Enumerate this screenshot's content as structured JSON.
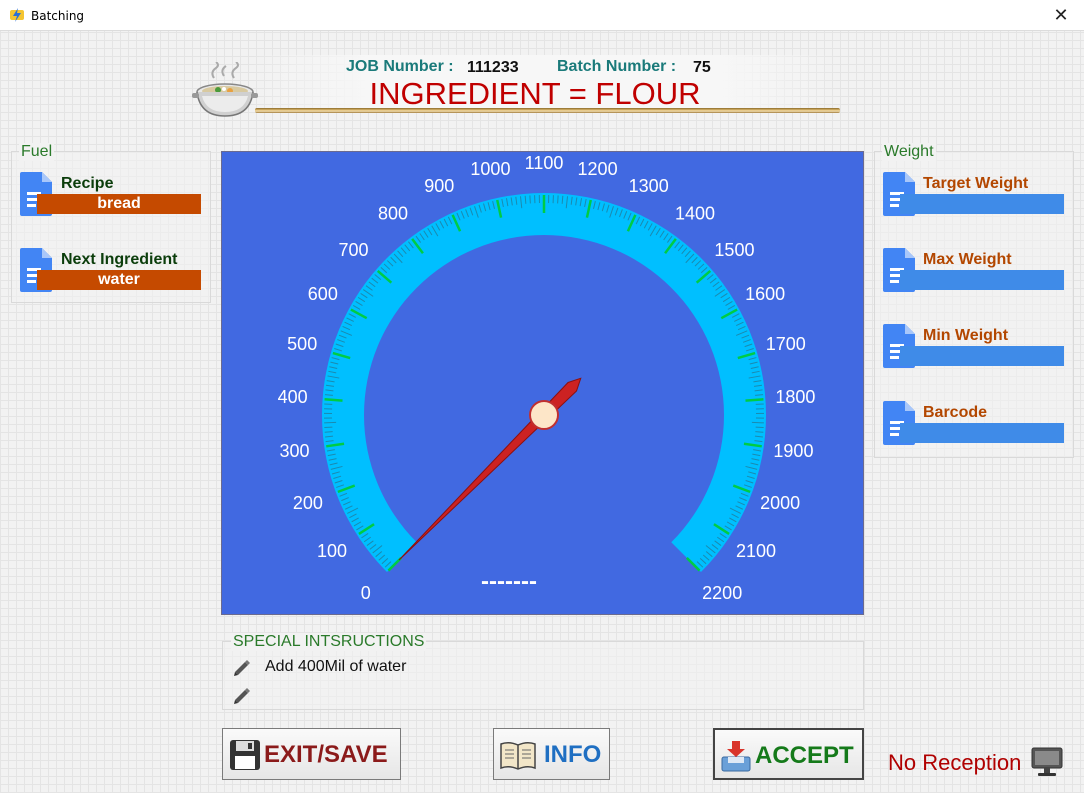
{
  "window": {
    "title": "Batching",
    "close_glyph": "✕",
    "icon": "lightning-app-icon"
  },
  "header": {
    "job_label": "JOB Number :",
    "job_value": "111233",
    "batch_label": "Batch Number :",
    "batch_value": "75",
    "ingredient": "INGREDIENT = FLOUR",
    "icon": "soup-pot-icon"
  },
  "fuel": {
    "title": "Fuel",
    "recipe_label": "Recipe",
    "recipe_value": "bread",
    "next_label": "Next Ingredient",
    "next_value": "water"
  },
  "weight": {
    "title": "Weight",
    "target_label": "Target Weight",
    "max_label": "Max Weight",
    "min_label": "Min Weight",
    "barcode_label": "Barcode"
  },
  "gauge": {
    "min": 0,
    "max": 2200,
    "major_step": 100,
    "value": 0,
    "start_angle_deg": 225,
    "end_angle_deg": -45,
    "tick_labels": [
      "0",
      "100",
      "200",
      "300",
      "400",
      "500",
      "600",
      "700",
      "800",
      "900",
      "1000",
      "1100",
      "1200",
      "1300",
      "1400",
      "1500",
      "1600",
      "1700",
      "1800",
      "1900",
      "2000",
      "2100",
      "2200"
    ],
    "readout": "-------",
    "colors": {
      "background": "#4169e1",
      "band": "#00bfff",
      "tick": "#00cc44",
      "needle": "#cc2222"
    }
  },
  "special": {
    "title": "SPECIAL INTSRUCTIONS",
    "line1": "Add 400Mil of water",
    "line2": "",
    "icon": "pencil-icon"
  },
  "buttons": {
    "exit": "EXIT/SAVE",
    "info": "INFO",
    "accept": "ACCEPT"
  },
  "status": {
    "reception": "No Reception",
    "icon": "computer-monitor-icon"
  }
}
